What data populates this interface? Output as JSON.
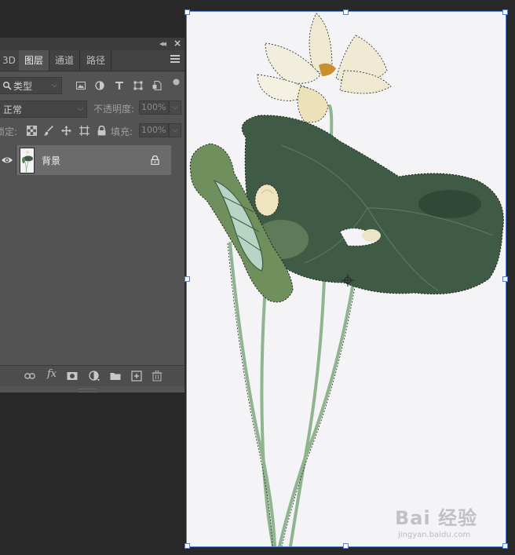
{
  "panel": {
    "tabs": [
      {
        "label": "3D"
      },
      {
        "label": "图层",
        "active": true
      },
      {
        "label": "通道"
      },
      {
        "label": "路径"
      }
    ],
    "filter": {
      "kind_label": "类型"
    },
    "blend_mode": {
      "value": "正常"
    },
    "opacity": {
      "label": "不透明度:",
      "value": "100%"
    },
    "lock": {
      "label": "锁定:"
    },
    "fill": {
      "label": "填充:",
      "value": "100%"
    },
    "layers": [
      {
        "name": "背景",
        "visible": true,
        "locked": true
      }
    ],
    "icons": {
      "collapse": "double-chevron-left-icon",
      "close": "close-icon",
      "menu": "hamburger-menu-icon"
    }
  },
  "watermark": {
    "brand": "Bai 经验",
    "sub": "jingyan.baidu.com"
  },
  "colors": {
    "panel_bg": "#535353",
    "selected_layer": "#6b6b6b",
    "canvas_bg": "#f4f4f6",
    "selection_border": "#5a7fcf",
    "leaf_dark": "#3f5a45",
    "stem": "#8fb48f"
  }
}
